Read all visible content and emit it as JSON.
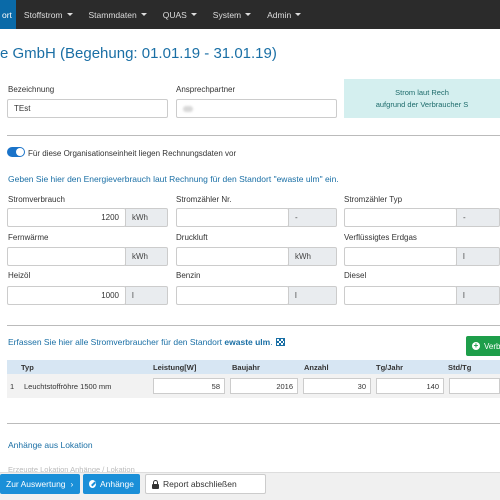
{
  "nav": {
    "items": [
      {
        "label": "ort",
        "active": true,
        "caret": false
      },
      {
        "label": "Stoffstrom",
        "active": false,
        "caret": true
      },
      {
        "label": "Stammdaten",
        "active": false,
        "caret": true
      },
      {
        "label": "QUAS",
        "active": false,
        "caret": true
      },
      {
        "label": "System",
        "active": false,
        "caret": true
      },
      {
        "label": "Admin",
        "active": false,
        "caret": true
      }
    ]
  },
  "page": {
    "title": "e GmbH (Begehung: 01.01.19 - 31.01.19)"
  },
  "header_form": {
    "bezeichnung_label": "Bezeichnung",
    "bezeichnung_value": "TEst",
    "ansprechpartner_label": "Ansprechpartner"
  },
  "info_box": {
    "line1": "Strom laut Rech",
    "line2": "aufgrund der Verbraucher S"
  },
  "toggle": {
    "label": "Für diese Organisationseinheit liegen Rechnungsdaten vor",
    "on": true
  },
  "energy": {
    "heading": "Geben Sie hier den Energieverbrauch laut Rechnung für den Standort \"ewaste ulm\" ein.",
    "fields": [
      {
        "label": "Stromverbrauch",
        "value": "1200",
        "unit": "kWh"
      },
      {
        "label": "Stromzähler Nr.",
        "value": "",
        "unit": "-"
      },
      {
        "label": "Stromzähler Typ",
        "value": "",
        "unit": "-"
      },
      {
        "label": "Fernwärme",
        "value": "",
        "unit": "kWh"
      },
      {
        "label": "Druckluft",
        "value": "",
        "unit": "kWh"
      },
      {
        "label": "Verflüssigtes Erdgas",
        "value": "",
        "unit": "l"
      },
      {
        "label": "Heizöl",
        "value": "1000",
        "unit": "l"
      },
      {
        "label": "Benzin",
        "value": "",
        "unit": "l"
      },
      {
        "label": "Diesel",
        "value": "",
        "unit": "l"
      }
    ]
  },
  "consumers": {
    "heading_prefix": "Erfassen Sie hier alle Stromverbraucher für den Standort",
    "heading_location": "ewaste ulm",
    "heading_suffix": ".",
    "add_button": "Verb",
    "columns": [
      "Typ",
      "Leistung[W]",
      "Baujahr",
      "Anzahl",
      "Tg/Jahr",
      "Std/Tg"
    ],
    "rows": [
      {
        "index": "1",
        "typ": "Leuchtstoffröhre 1500 mm",
        "leistung": "58",
        "baujahr": "2016",
        "anzahl": "30",
        "tg_jahr": "140",
        "std_tg": ""
      }
    ]
  },
  "attachments": {
    "heading": "Anhänge aus Lokation",
    "faint_text": "Erzeugte Lokation Anhänge / Lokation"
  },
  "footer": {
    "auswertung": "Zur Auswertung",
    "anhaenge": "Anhänge",
    "report": "Report abschließen"
  },
  "colors": {
    "nav_bg": "#2b2b2b",
    "nav_active": "#0a6aa8",
    "title": "#1a6fa5",
    "info_bg": "#d4efef",
    "green": "#1e9e4a",
    "blue_btn": "#1a8fd8",
    "table_head": "#d7e6f3"
  }
}
